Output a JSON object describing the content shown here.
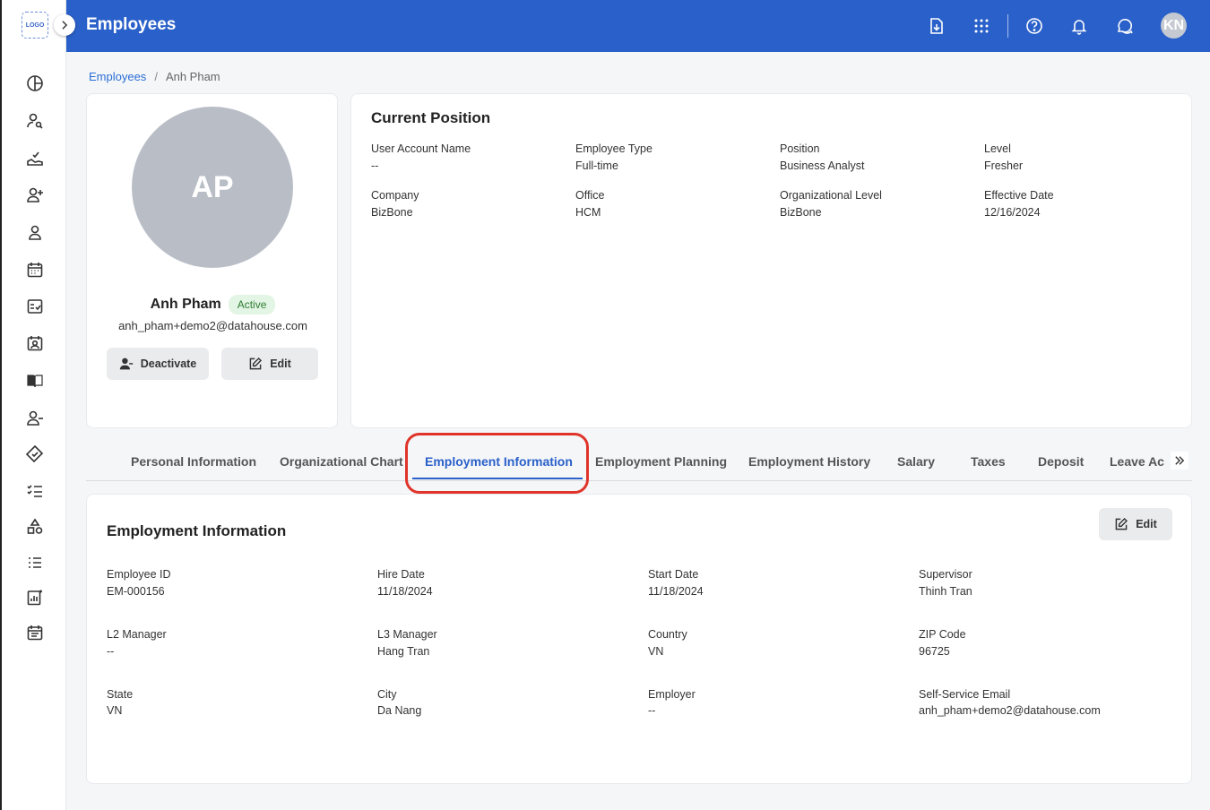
{
  "app": {
    "logo_text": "LOGO",
    "title": "Employees"
  },
  "header": {
    "avatar_initials": "KN"
  },
  "breadcrumb": {
    "parent": "Employees",
    "separator": "/",
    "current": "Anh Pham"
  },
  "profile": {
    "initials": "AP",
    "name": "Anh Pham",
    "status": "Active",
    "email": "anh_pham+demo2@datahouse.com",
    "deactivate_label": "Deactivate",
    "edit_label": "Edit"
  },
  "current_position": {
    "title": "Current Position",
    "fields": [
      {
        "label": "User Account Name",
        "value": "--"
      },
      {
        "label": "Employee Type",
        "value": "Full-time"
      },
      {
        "label": "Position",
        "value": "Business Analyst"
      },
      {
        "label": "Level",
        "value": "Fresher"
      },
      {
        "label": "Company",
        "value": "BizBone"
      },
      {
        "label": "Office",
        "value": "HCM"
      },
      {
        "label": "Organizational Level",
        "value": "BizBone"
      },
      {
        "label": "Effective Date",
        "value": "12/16/2024"
      }
    ]
  },
  "tabs": [
    "Personal Information",
    "Organizational Chart",
    "Employment Information",
    "Employment Planning",
    "Employment History",
    "Salary",
    "Taxes",
    "Deposit",
    "Leave Ac"
  ],
  "active_tab": "Employment Information",
  "employment": {
    "title": "Employment Information",
    "edit_label": "Edit",
    "fields": [
      {
        "label": "Employee ID",
        "value": "EM-000156"
      },
      {
        "label": "Hire Date",
        "value": "11/18/2024"
      },
      {
        "label": "Start Date",
        "value": "11/18/2024"
      },
      {
        "label": "Supervisor",
        "value": "Thinh Tran"
      },
      {
        "label": "L2 Manager",
        "value": "--"
      },
      {
        "label": "L3 Manager",
        "value": "Hang Tran"
      },
      {
        "label": "Country",
        "value": "VN"
      },
      {
        "label": "ZIP Code",
        "value": "96725"
      },
      {
        "label": "State",
        "value": "VN"
      },
      {
        "label": "City",
        "value": "Da Nang"
      },
      {
        "label": "Employer",
        "value": "--"
      },
      {
        "label": "Self-Service Email",
        "value": "anh_pham+demo2@datahouse.com"
      }
    ]
  },
  "colors": {
    "primary": "#2a60c9",
    "highlight": "#e0342a",
    "active_badge_bg": "#e3f5e4",
    "active_badge_text": "#2e7d32"
  }
}
